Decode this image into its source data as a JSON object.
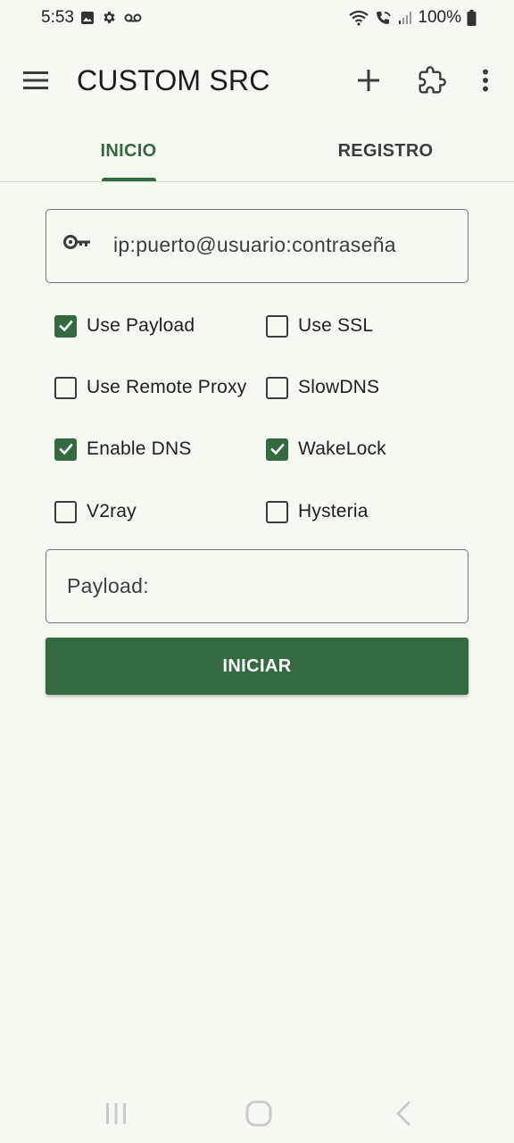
{
  "status_bar": {
    "time": "5:53",
    "battery": "100%",
    "left_icons": [
      "image-icon",
      "gear-icon",
      "voicemail-icon"
    ],
    "right_icons": [
      "wifi-icon",
      "wifi-calling-icon",
      "signal-icon",
      "battery-icon"
    ]
  },
  "app_bar": {
    "title": "CUSTOM SRC",
    "actions": [
      "add-icon",
      "puzzle-icon",
      "more-vert-icon"
    ]
  },
  "tabs": [
    {
      "label": "INICIO",
      "active": true
    },
    {
      "label": "REGISTRO",
      "active": false
    }
  ],
  "server": {
    "value": "ip:puerto@usuario:contraseña",
    "icon": "key-icon"
  },
  "options": [
    {
      "label": "Use Payload",
      "checked": true
    },
    {
      "label": "Use SSL",
      "checked": false
    },
    {
      "label": "Use Remote Proxy",
      "checked": false
    },
    {
      "label": "SlowDNS",
      "checked": false
    },
    {
      "label": "Enable DNS",
      "checked": true
    },
    {
      "label": "WakeLock",
      "checked": true
    },
    {
      "label": "V2ray",
      "checked": false
    },
    {
      "label": "Hysteria",
      "checked": false
    }
  ],
  "payload": {
    "label": "Payload:"
  },
  "start_button": {
    "label": "INICIAR"
  },
  "colors": {
    "accent": "#356a40",
    "background": "#f6f9f1"
  }
}
